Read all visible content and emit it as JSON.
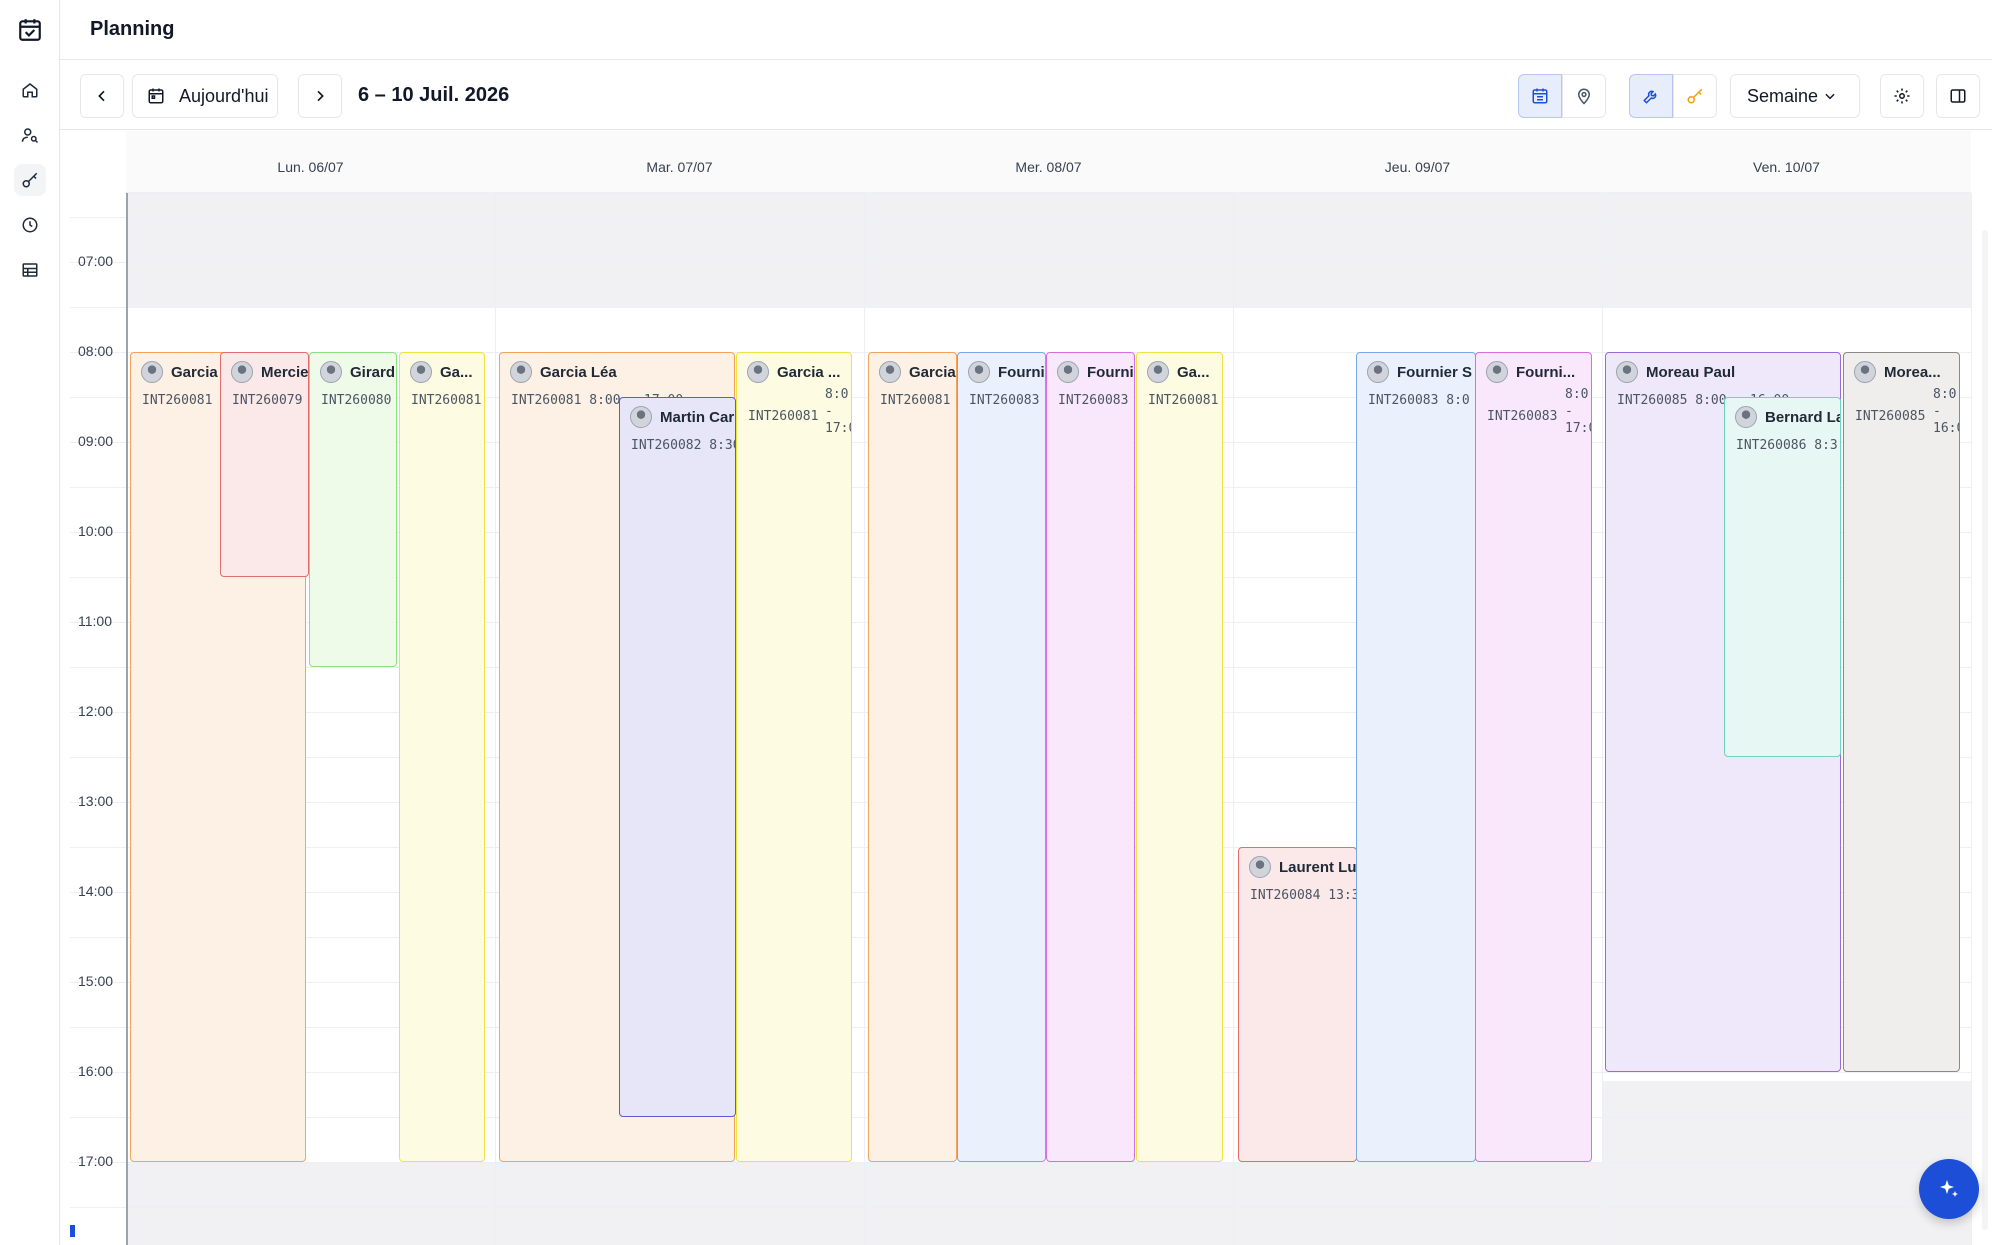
{
  "header": {
    "title": "Planning"
  },
  "sidebar": {
    "items": [
      {
        "name": "home-icon"
      },
      {
        "name": "user-search-icon"
      },
      {
        "name": "key-icon"
      },
      {
        "name": "clock-icon"
      },
      {
        "name": "table-icon"
      }
    ],
    "active_item": "key-icon"
  },
  "toolbar": {
    "today_label": "Aujourd'hui",
    "range_label": "6 – 10 Juil. 2026",
    "view_label": "Semaine"
  },
  "calendar": {
    "days": [
      "Lun. 06/07",
      "Mar. 07/07",
      "Mer. 08/07",
      "Jeu. 09/07",
      "Ven. 10/07"
    ],
    "hours": [
      "07:00",
      "08:00",
      "09:00",
      "10:00",
      "11:00",
      "12:00",
      "13:00",
      "14:00",
      "15:00",
      "16:00",
      "17:00"
    ],
    "events": [
      {
        "day": 0,
        "name": "Garcia",
        "ref": "INT260081",
        "color": "#f4a35a",
        "fill": "#fdf0e4"
      },
      {
        "day": 0,
        "name": "Mercie",
        "ref": "INT260079",
        "color": "#e26d6d",
        "fill": "#fbe8e8"
      },
      {
        "day": 0,
        "name": "Girard",
        "ref": "INT260080",
        "color": "#8fe07e",
        "fill": "#effbe9"
      },
      {
        "day": 0,
        "name": "Ga...",
        "ref": "INT260081",
        "color": "#f0e33f",
        "fill": "#fdfbe2"
      },
      {
        "day": 1,
        "name": "Garcia Léa",
        "ref": "INT260081  8:00 - 17:00",
        "color": "#f4a35a",
        "fill": "#fdf0e4"
      },
      {
        "day": 1,
        "name": "Martin Car",
        "ref": "INT260082  8:30",
        "color": "#5b5bd6",
        "fill": "#e6e6f8"
      },
      {
        "day": 1,
        "name": "Garcia ...",
        "ref": "INT260081",
        "time_col": [
          "8:0",
          "-",
          "17:0"
        ],
        "color": "#f0e33f",
        "fill": "#fdfbe2"
      },
      {
        "day": 2,
        "name": "Garcia",
        "ref": "INT260081",
        "color": "#f4a35a",
        "fill": "#fdf0e4"
      },
      {
        "day": 2,
        "name": "Fourni",
        "ref": "INT260083",
        "color": "#7aa6ea",
        "fill": "#eaf1fc"
      },
      {
        "day": 2,
        "name": "Fourni",
        "ref": "INT260083",
        "color": "#d86de0",
        "fill": "#f9e8fb"
      },
      {
        "day": 2,
        "name": "Ga...",
        "ref": "INT260081",
        "color": "#f0e33f",
        "fill": "#fdfbe2"
      },
      {
        "day": 3,
        "name": "Laurent Lu",
        "ref": "INT260084  13:3",
        "color": "#e26d6d",
        "fill": "#fbe8e8"
      },
      {
        "day": 3,
        "name": "Fournier S",
        "ref": "INT260083  8:0",
        "color": "#7aa6ea",
        "fill": "#eaf1fc"
      },
      {
        "day": 3,
        "name": "Fourni...",
        "ref": "INT260083",
        "time_col": [
          "8:0",
          "-",
          "17:0"
        ],
        "color": "#d86de0",
        "fill": "#f9e8fb"
      },
      {
        "day": 4,
        "name": "Moreau Paul",
        "ref": "INT260085  8:00 - 16:00",
        "color": "#9b6ad8",
        "fill": "#efe7fa"
      },
      {
        "day": 4,
        "name": "Bernard La",
        "ref": "INT260086  8:3",
        "color": "#6fd3bf",
        "fill": "#e7f8f4"
      },
      {
        "day": 4,
        "name": "Morea...",
        "ref": "INT260085",
        "time_col": [
          "8:0",
          "-",
          "16:0"
        ],
        "color": "#8a8a8a",
        "fill": "#efeeec"
      }
    ]
  },
  "colors": {
    "accent": "#1d4ed8",
    "selected_bg": "#e8edfb"
  }
}
